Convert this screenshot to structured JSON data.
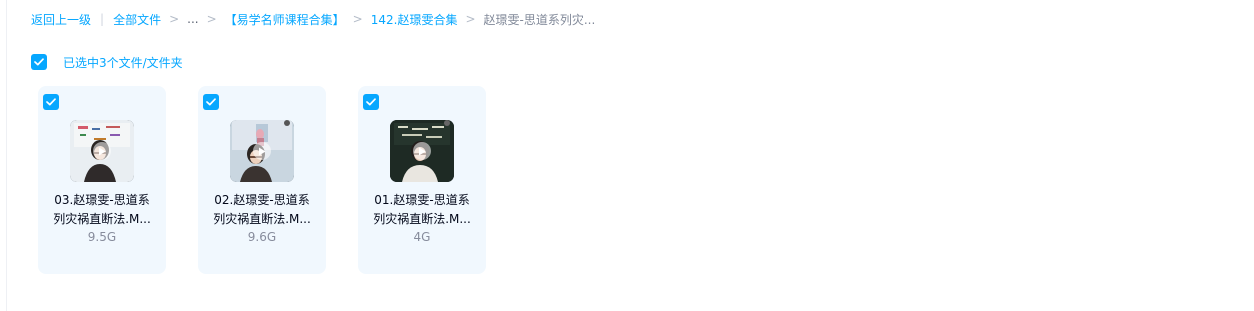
{
  "breadcrumb": {
    "back": "返回上一级",
    "items": [
      "全部文件",
      "...",
      "【易学名师课程合集】",
      "142.赵璟雯合集"
    ],
    "current": "赵璟雯-思道系列灾..."
  },
  "selection": {
    "label": "已选中3个文件/文件夹",
    "checked": true
  },
  "files": [
    {
      "name_line1": "03.赵璟雯-思道系",
      "name_line2": "列灾祸直断法.M...",
      "size": "9.5G",
      "checked": true
    },
    {
      "name_line1": "02.赵璟雯-思道系",
      "name_line2": "列灾祸直断法.M...",
      "size": "9.6G",
      "checked": true
    },
    {
      "name_line1": "01.赵璟雯-思道系",
      "name_line2": "列灾祸直断法.M...",
      "size": "4G",
      "checked": true
    }
  ],
  "colors": {
    "accent": "#06a7ff",
    "card_bg": "#f1f8fe",
    "muted_text": "#818999"
  },
  "icons": {
    "checkbox": "checkmark-icon",
    "play": "play-icon",
    "thumbnail": "video-thumbnail"
  }
}
